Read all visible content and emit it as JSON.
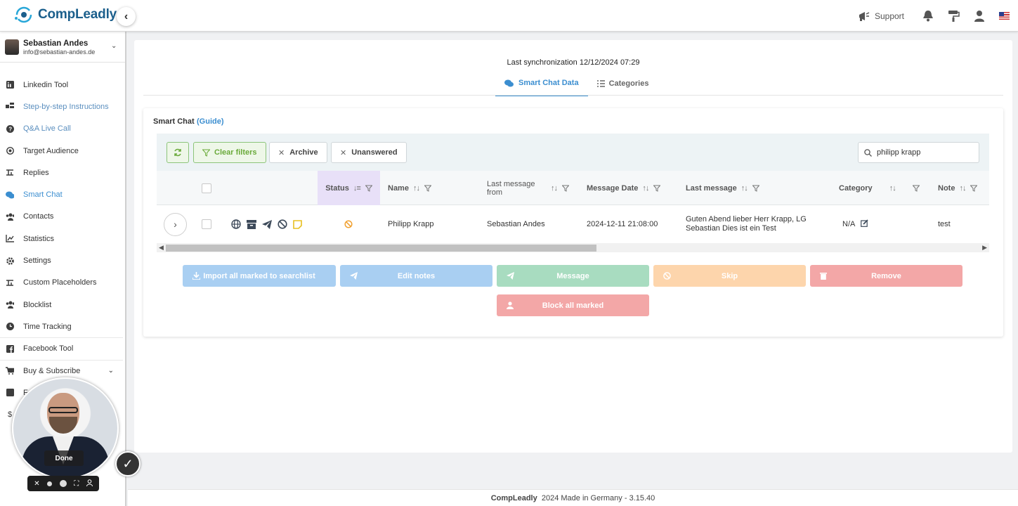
{
  "app": {
    "logo_text": "CompLeadly"
  },
  "topbar": {
    "support_label": "Support",
    "collapse_glyph": "‹"
  },
  "user": {
    "name": "Sebastian Andes",
    "email": "info@sebastian-andes.de"
  },
  "sidebar": {
    "items": [
      {
        "label": "Linkedin Tool",
        "icon": "linkedin-icon"
      },
      {
        "label": "Step-by-step Instructions",
        "icon": "steps-icon"
      },
      {
        "label": "Q&A Live Call",
        "icon": "question-icon"
      },
      {
        "label": "Target Audience",
        "icon": "target-icon"
      },
      {
        "label": "Replies",
        "icon": "replies-icon"
      },
      {
        "label": "Smart Chat",
        "icon": "chat-icon"
      },
      {
        "label": "Contacts",
        "icon": "contacts-icon"
      },
      {
        "label": "Statistics",
        "icon": "statistics-icon"
      },
      {
        "label": "Settings",
        "icon": "settings-icon"
      },
      {
        "label": "Custom Placeholders",
        "icon": "placeholders-icon"
      },
      {
        "label": "Blocklist",
        "icon": "blocklist-icon"
      },
      {
        "label": "Time Tracking",
        "icon": "clock-icon"
      },
      {
        "label": "Facebook Tool",
        "icon": "facebook-icon"
      },
      {
        "label": "Buy & Subscribe",
        "icon": "cart-icon"
      },
      {
        "label": "F",
        "icon": "facebook-icon"
      },
      {
        "label": "",
        "icon": "dollar-icon"
      }
    ]
  },
  "video": {
    "done_label": "Done"
  },
  "main": {
    "sync_text": "Last synchronization 12/12/2024 07:29",
    "tabs": [
      {
        "label": "Smart Chat Data"
      },
      {
        "label": "Categories"
      }
    ],
    "panel_title": "Smart Chat",
    "guide_label": "(Guide)",
    "toolbar": {
      "clear_filters": "Clear filters",
      "archive": "Archive",
      "unanswered": "Unanswered",
      "search_value": "philipp krapp"
    },
    "columns": {
      "status": "Status",
      "name": "Name",
      "last_message_from": "Last message from",
      "message_date": "Message Date",
      "last_message": "Last message",
      "category": "Category",
      "note": "Note"
    },
    "rows": [
      {
        "name": "Philipp Krapp",
        "last_message_from": "Sebastian Andes",
        "message_date": "2024-12-11 21:08:00",
        "last_message": "Guten Abend lieber Herr Krapp, LG Sebastian Dies ist ein Test",
        "category": "N/A",
        "note": "test"
      }
    ],
    "actions": {
      "import": "Import all marked to searchlist",
      "edit_notes": "Edit notes",
      "message": "Message",
      "skip": "Skip",
      "remove": "Remove",
      "block": "Block all marked"
    }
  },
  "footer": {
    "brand": "CompLeadly",
    "text": "2024 Made in Germany - 3.15.40"
  },
  "colors": {
    "accent": "#3b8ed0",
    "brand": "#1b5f8c",
    "green": "#6aaa3a"
  }
}
